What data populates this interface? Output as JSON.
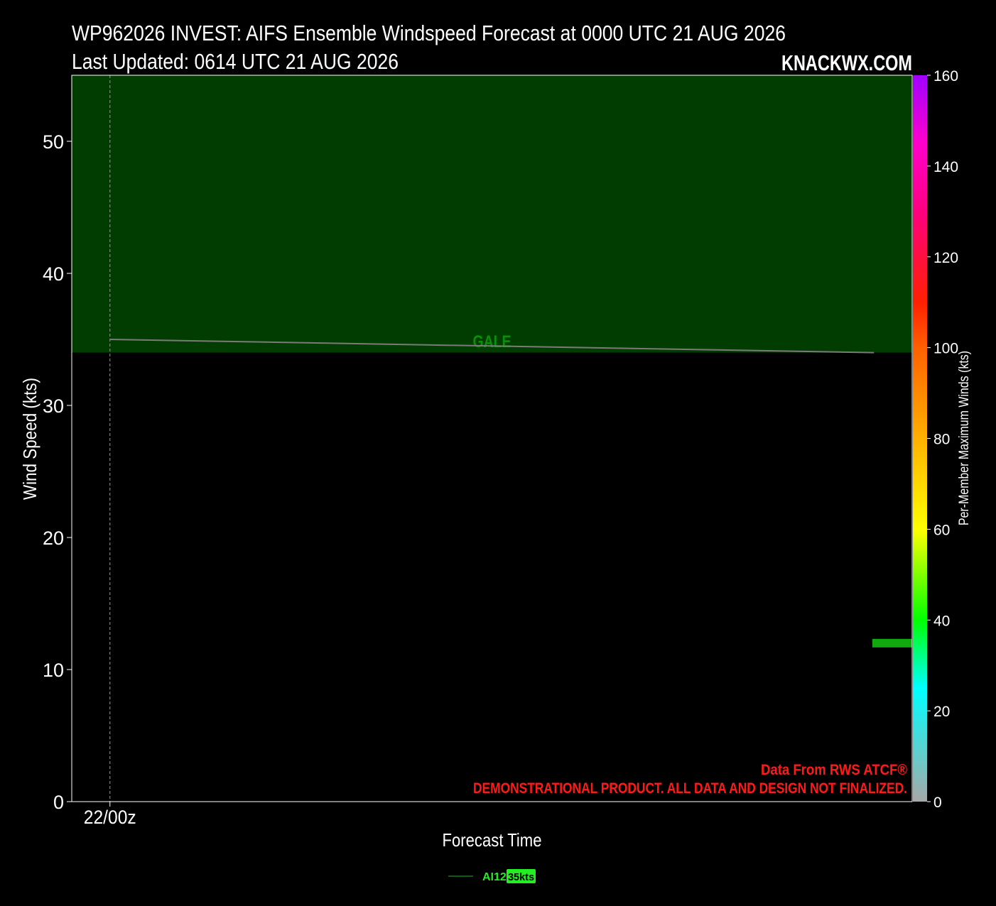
{
  "header": {
    "title": "WP962026 INVEST: AIFS Ensemble Windspeed Forecast at 0000 UTC 21 AUG 2026",
    "subtitle": "Last Updated: 0614 UTC 21 AUG 2026",
    "brand": "KNACKWX.COM"
  },
  "footer_notes": {
    "source": "Data From RWS ATCF®",
    "disclaimer": "DEMONSTRATIONAL PRODUCT. ALL DATA AND DESIGN NOT FINALIZED."
  },
  "colors": {
    "background": "#000000",
    "gale_band": "#023d00",
    "gale_label": "#0a8f0a",
    "source_text": "#ff1a1a",
    "member_line": "#7a7a7a",
    "legend_line": "#0f5a0f",
    "legend_text": "#22ee22",
    "legend_badge": "#22ee22",
    "wind_bar": "#10aa10"
  },
  "chart_data": {
    "type": "line",
    "xlabel": "Forecast Time",
    "ylabel": "Wind Speed (kts)",
    "ylim": [
      0,
      55
    ],
    "yticks": [
      0,
      10,
      20,
      30,
      40,
      50
    ],
    "x_tick_labels": [
      "22/00z"
    ],
    "x_tick_positions": [
      0
    ],
    "xlim": [
      -0.4,
      8.4
    ],
    "grid": false,
    "bands": [
      {
        "label": "GALE",
        "from": 34,
        "to": 55,
        "label_x": 4.0,
        "label_y": 34.9
      }
    ],
    "series": [
      {
        "name": "AI12",
        "x": [
          0,
          8
        ],
        "y": [
          35,
          34
        ],
        "legend_value": "35kts"
      }
    ],
    "member_max_bar": {
      "value": 12,
      "color_value": 35
    },
    "colorbar": {
      "label": "Per-Member Maximum Winds (kts)",
      "min": 0,
      "max": 160,
      "ticks": [
        0,
        20,
        40,
        60,
        80,
        100,
        120,
        140,
        160
      ],
      "stops": [
        {
          "v": 0,
          "c": "#a8a8a8"
        },
        {
          "v": 25,
          "c": "#00ffff"
        },
        {
          "v": 40,
          "c": "#00ff00"
        },
        {
          "v": 60,
          "c": "#ffff00"
        },
        {
          "v": 80,
          "c": "#ffb000"
        },
        {
          "v": 100,
          "c": "#ff6000"
        },
        {
          "v": 110,
          "c": "#ff2000"
        },
        {
          "v": 130,
          "c": "#ff0080"
        },
        {
          "v": 145,
          "c": "#ff00cc"
        },
        {
          "v": 160,
          "c": "#a000ff"
        }
      ]
    },
    "legend_placement": "bottom-center"
  }
}
